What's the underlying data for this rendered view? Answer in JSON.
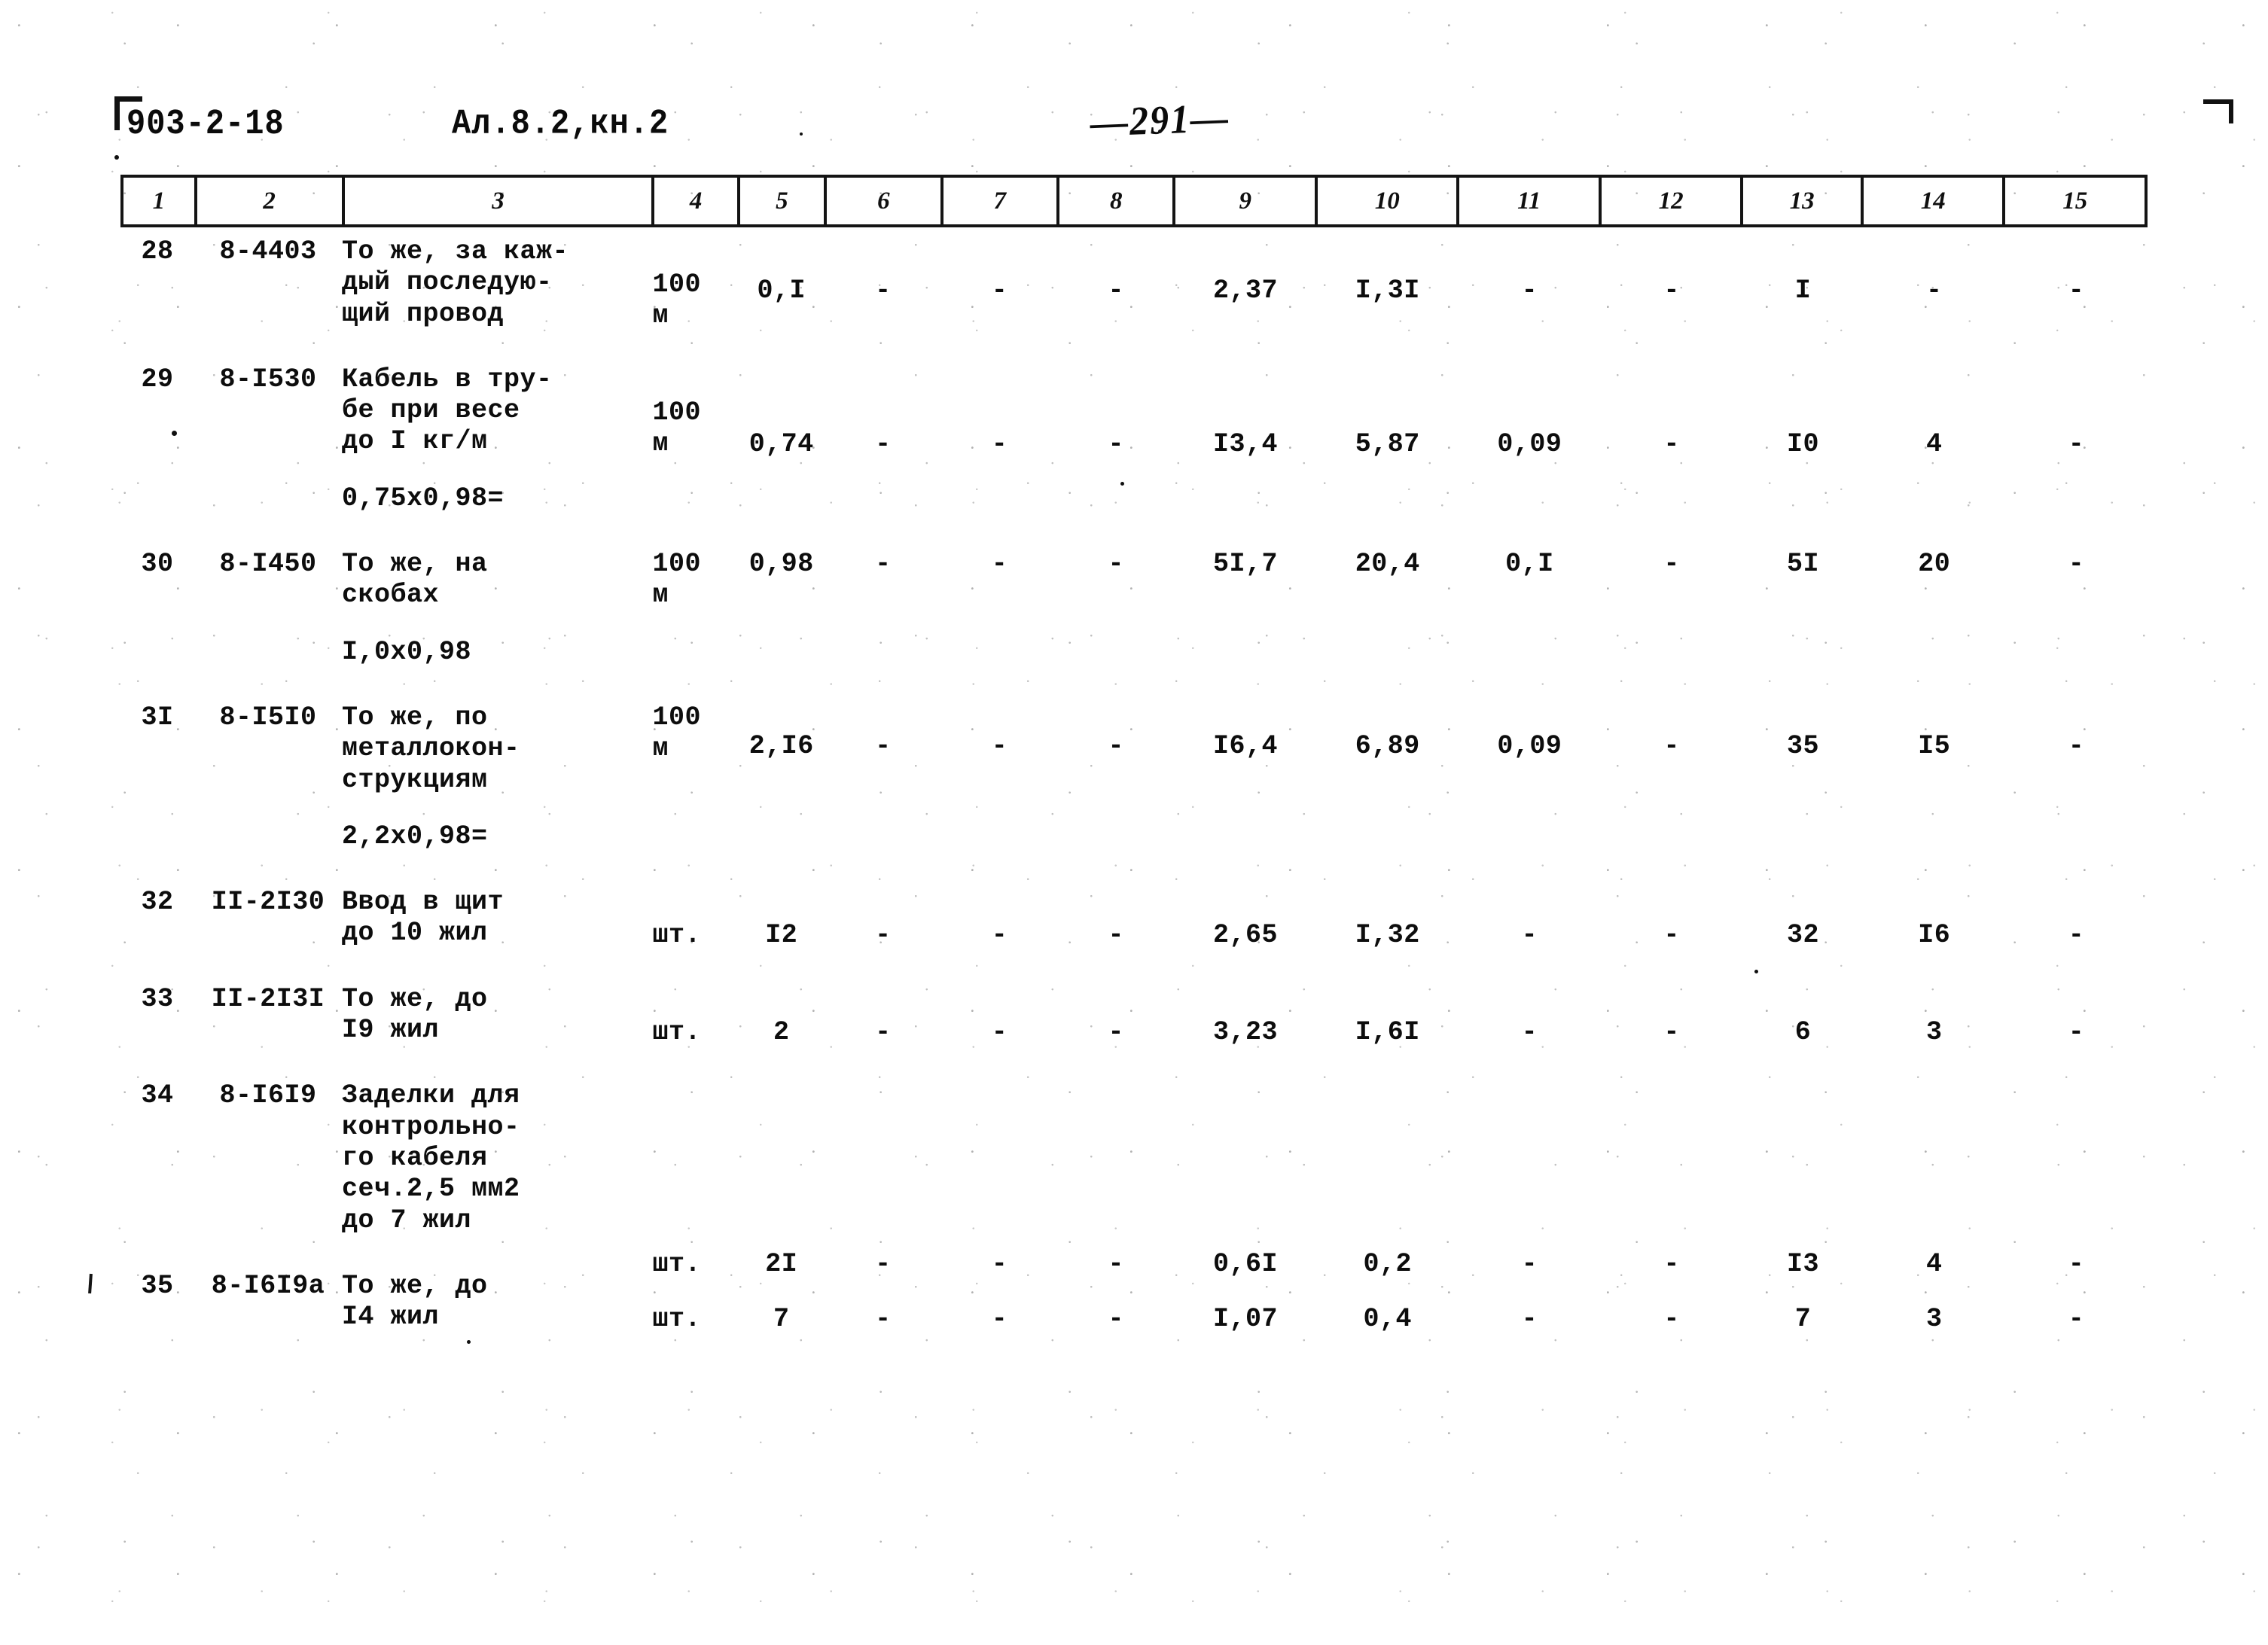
{
  "header": {
    "doc_code": "903-2-18",
    "album_code": "Ал.8.2,кн.2",
    "page_number": "—291—"
  },
  "table": {
    "column_headers": [
      "1",
      "2",
      "3",
      "4",
      "5",
      "6",
      "7",
      "8",
      "9",
      "10",
      "11",
      "12",
      "13",
      "14",
      "15"
    ],
    "rows": [
      {
        "no": "28",
        "code": "8-4403",
        "name_lines": [
          "То же, за каж-",
          "дый последую-",
          "щий провод"
        ],
        "note": "",
        "unit_lines": [
          "100",
          "м"
        ],
        "values": [
          "0,I",
          "-",
          "-",
          "-",
          "2,37",
          "I,3I",
          "-",
          "-",
          "I",
          "-",
          "-"
        ]
      },
      {
        "no": "29",
        "code": "8-I530",
        "name_lines": [
          "Кабель в тру-",
          "бе при весе",
          "до I кг/м"
        ],
        "note": "0,75х0,98=",
        "unit_lines": [
          "100",
          "м"
        ],
        "values": [
          "0,74",
          "-",
          "-",
          "-",
          "I3,4",
          "5,87",
          "0,09",
          "-",
          "I0",
          "4",
          "-"
        ]
      },
      {
        "no": "30",
        "code": "8-I450",
        "name_lines": [
          "То же, на",
          "скобах"
        ],
        "note": "I,0х0,98",
        "unit_lines": [
          "100",
          "м"
        ],
        "values": [
          "0,98",
          "-",
          "-",
          "-",
          "5I,7",
          "20,4",
          "0,I",
          "-",
          "5I",
          "20",
          "-"
        ]
      },
      {
        "no": "3I",
        "code": "8-I5I0",
        "name_lines": [
          "То же, по",
          "металлокон-",
          "струкциям"
        ],
        "note": "2,2х0,98=",
        "unit_lines": [
          "100",
          "м"
        ],
        "values": [
          "2,I6",
          "-",
          "-",
          "-",
          "I6,4",
          "6,89",
          "0,09",
          "-",
          "35",
          "I5",
          "-"
        ]
      },
      {
        "no": "32",
        "code": "II-2I30",
        "name_lines": [
          "Ввод в щит",
          "до 10 жил"
        ],
        "note": "",
        "unit_lines": [
          "шт."
        ],
        "values": [
          "I2",
          "-",
          "-",
          "-",
          "2,65",
          "I,32",
          "-",
          "-",
          "32",
          "I6",
          "-"
        ]
      },
      {
        "no": "33",
        "code": "II-2I3I",
        "name_lines": [
          "То же, до",
          "I9 жил"
        ],
        "note": "",
        "unit_lines": [
          "шт."
        ],
        "values": [
          "2",
          "-",
          "-",
          "-",
          "3,23",
          "I,6I",
          "-",
          "-",
          "6",
          "3",
          "-"
        ]
      },
      {
        "no": "34",
        "code": "8-I6I9",
        "name_lines": [
          "Заделки для",
          "контрольно-",
          "го кабеля",
          "сеч.2,5 мм2",
          "до 7 жил"
        ],
        "note": "",
        "unit_lines": [
          "шт."
        ],
        "values": [
          "2I",
          "-",
          "-",
          "-",
          "0,6I",
          "0,2",
          "-",
          "-",
          "I3",
          "4",
          "-"
        ]
      },
      {
        "no": "35",
        "code": "8-I6I9а",
        "name_lines": [
          "То же, до",
          "I4 жил"
        ],
        "note": "",
        "unit_lines": [
          "шт."
        ],
        "values": [
          "7",
          "-",
          "-",
          "-",
          "I,07",
          "0,4",
          "-",
          "-",
          "7",
          "3",
          "-"
        ]
      }
    ]
  }
}
